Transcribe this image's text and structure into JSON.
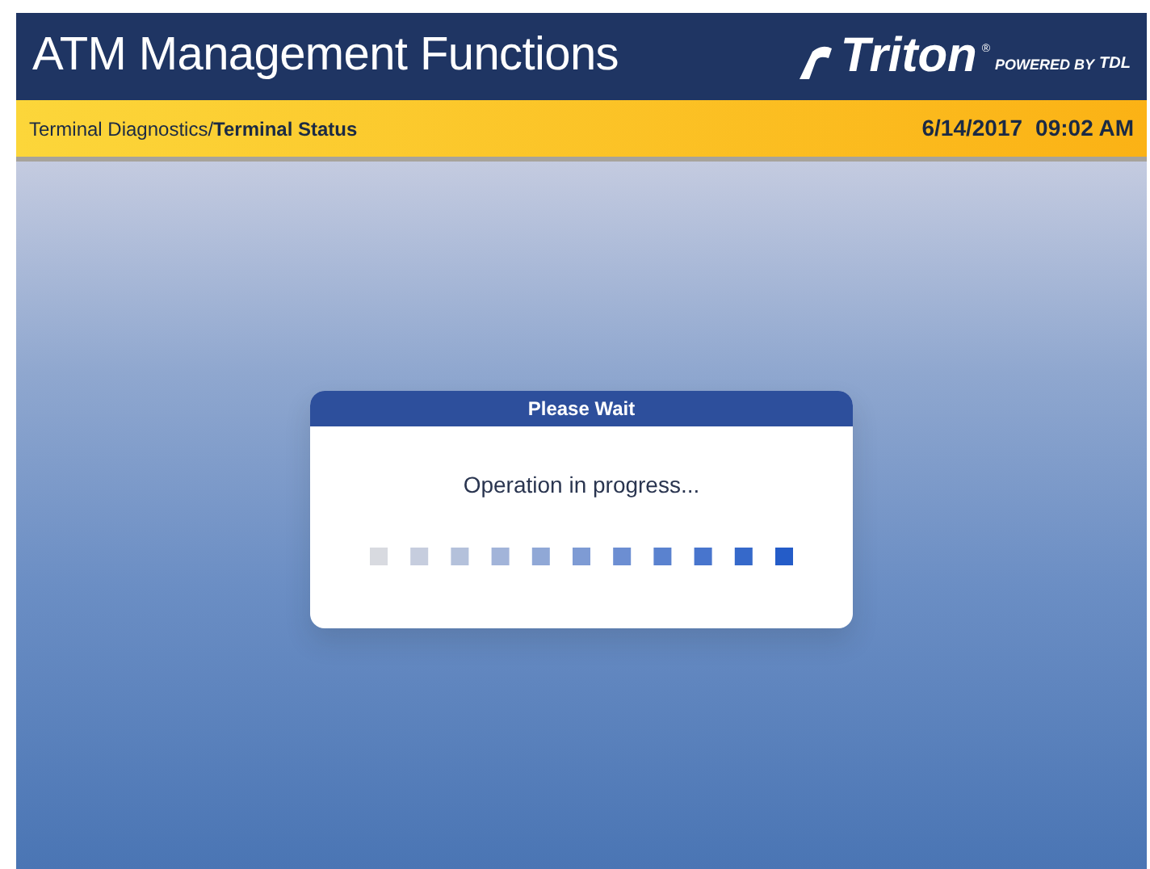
{
  "header": {
    "title": "ATM Management Functions",
    "logo": {
      "brand": "Triton",
      "mark": "®",
      "tagline": "POWERED BY",
      "partner": "TDL"
    }
  },
  "breadcrumb_bar": {
    "path": "Terminal Diagnostics/**Terminal Status**",
    "date": "6/14/2017",
    "time": "09:02 AM"
  },
  "dialog": {
    "title": "Please Wait",
    "message": "Operation in progress..."
  }
}
